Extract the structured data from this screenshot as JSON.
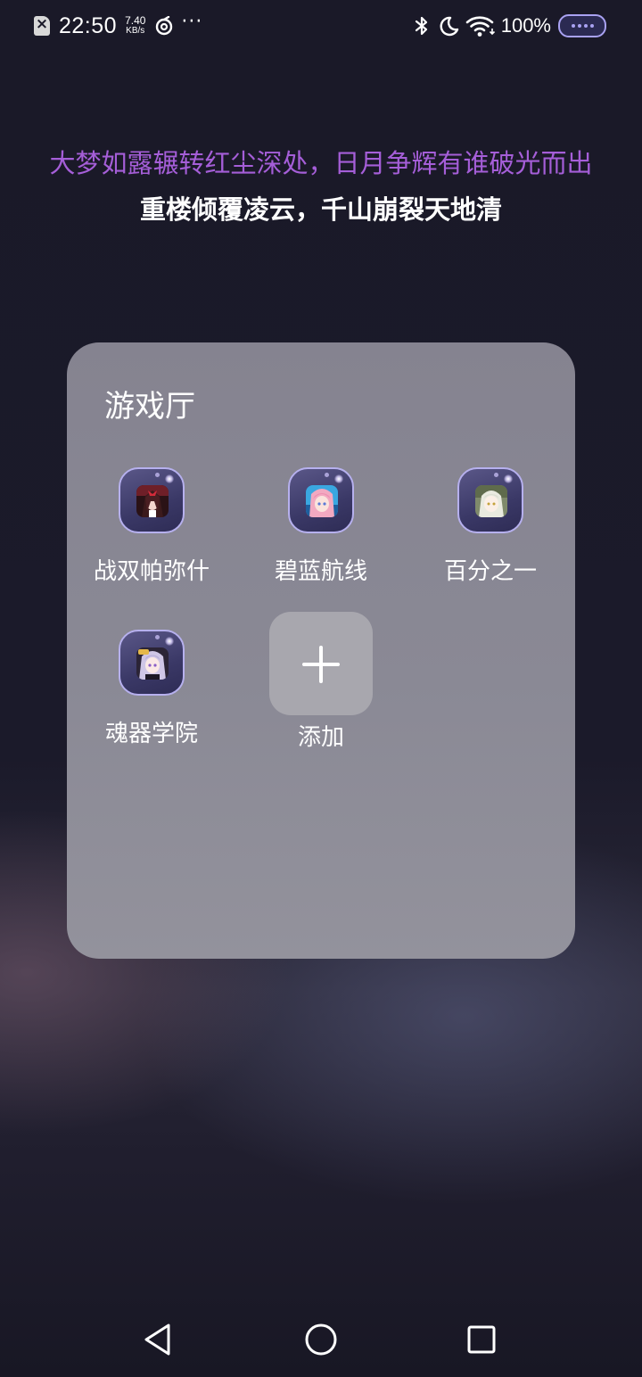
{
  "status_bar": {
    "time": "22:50",
    "net_speed_value": "7.40",
    "net_speed_unit": "KB/s",
    "more": "···",
    "battery": "100%",
    "icons": [
      "sim-disabled-icon",
      "sync-icon",
      "bluetooth-icon",
      "moon-icon",
      "wifi-icon",
      "battery-icon"
    ]
  },
  "lyrics": {
    "line1": "大梦如露辗转红尘深处，日月争辉有谁破光而出",
    "line2": "重楼倾覆凌云，千山崩裂天地清",
    "line1_color": "#a55ed8",
    "line2_color": "#ffffff"
  },
  "folder": {
    "title": "游戏厅",
    "apps": [
      {
        "label": "战双帕弥什"
      },
      {
        "label": "碧蓝航线"
      },
      {
        "label": "百分之一"
      },
      {
        "label": "魂器学院"
      }
    ],
    "add_label": "添加"
  },
  "nav": {
    "icons": [
      "back-icon",
      "home-icon",
      "recents-icon"
    ]
  }
}
